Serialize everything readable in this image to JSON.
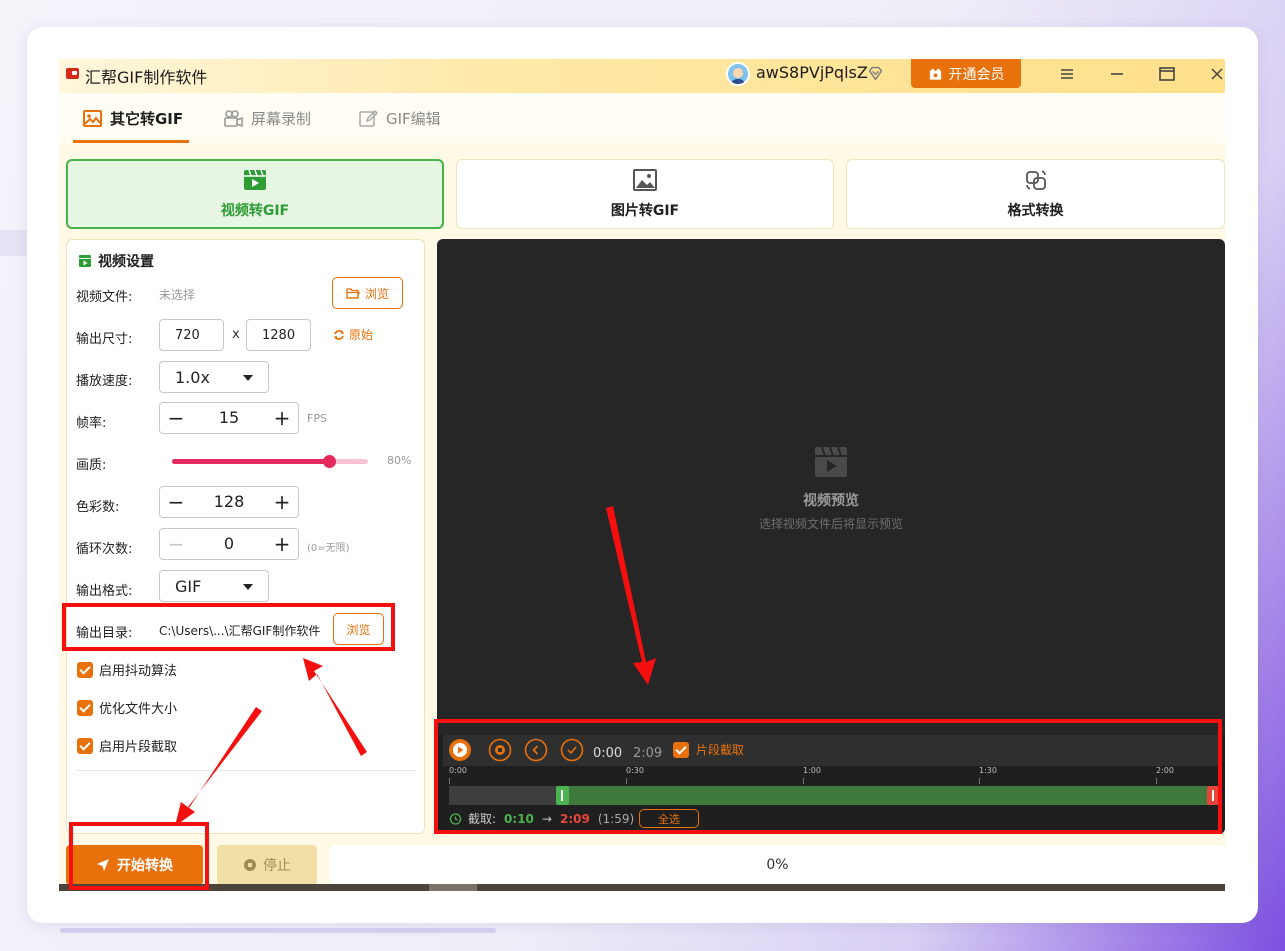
{
  "app": {
    "title": "汇帮GIF制作软件",
    "username": "awS8PVjPqlsZ",
    "vip_label": "开通会员",
    "accent_color": "#e8710c",
    "annotation_color": "#f50f0f"
  },
  "tabs": [
    {
      "label": "其它转GIF",
      "icon": "image-icon",
      "active": true
    },
    {
      "label": "屏幕录制",
      "icon": "camera-icon",
      "active": false
    },
    {
      "label": "GIF编辑",
      "icon": "edit-icon",
      "active": false
    }
  ],
  "modes": [
    {
      "label": "视频转GIF",
      "icon": "video-icon",
      "active": true
    },
    {
      "label": "图片转GIF",
      "icon": "picture-icon",
      "active": false
    },
    {
      "label": "格式转换",
      "icon": "convert-icon",
      "active": false
    }
  ],
  "settings": {
    "title": "视频设置",
    "video_file": {
      "label": "视频文件:",
      "value": "未选择",
      "browse_label": "浏览"
    },
    "output_size": {
      "label": "输出尺寸:",
      "width": "720",
      "separator": "x",
      "height": "1280",
      "original_label": "原始"
    },
    "speed": {
      "label": "播放速度:",
      "value": "1.0x"
    },
    "fps": {
      "label": "帧率:",
      "value": "15",
      "unit": "FPS"
    },
    "quality": {
      "label": "画质:",
      "value_text": "80%",
      "value": 0.8
    },
    "colors": {
      "label": "色彩数:",
      "value": "128"
    },
    "loop": {
      "label": "循环次数:",
      "value": "0",
      "hint": "(0=无限)"
    },
    "format": {
      "label": "输出格式:",
      "value": "GIF"
    },
    "output_dir": {
      "label": "输出目录:",
      "value": "C:\\Users\\...\\汇帮GIF制作软件",
      "browse_label": "浏览"
    },
    "checkboxes": [
      {
        "label": "启用抖动算法",
        "checked": true
      },
      {
        "label": "优化文件大小",
        "checked": true
      },
      {
        "label": "启用片段截取",
        "checked": true
      }
    ]
  },
  "preview": {
    "title": "视频预览",
    "subtitle": "选择视频文件后将显示预览",
    "current_time": "0:00",
    "total_time": "2:09",
    "segment_label": "片段截取",
    "ruler": [
      "0:00",
      "0:30",
      "1:00",
      "1:30",
      "2:00"
    ],
    "clip_label": "截取:",
    "clip_start": "0:10",
    "clip_arrow": "→",
    "clip_end": "2:09",
    "clip_duration": "(1:59)",
    "select_all_label": "全选",
    "timeline_total_seconds": 129,
    "clip_start_seconds": 10,
    "clip_end_seconds": 129
  },
  "footer": {
    "start_label": "开始转换",
    "stop_label": "停止",
    "progress_text": "0%",
    "progress": 0
  }
}
